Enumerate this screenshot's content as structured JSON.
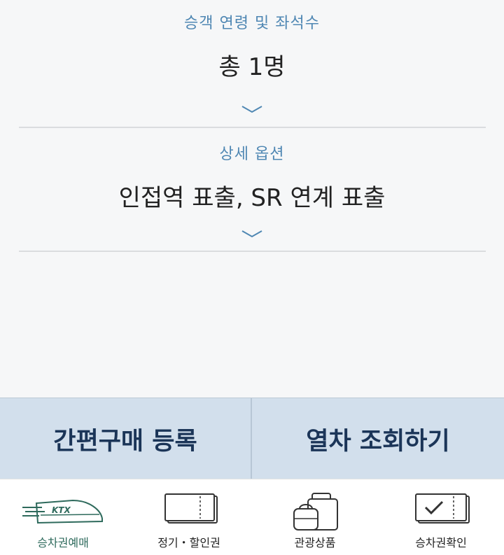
{
  "passenger_section": {
    "label": "승객 연령 및 좌석수",
    "value": "총 1명"
  },
  "options_section": {
    "label": "상세 옵션",
    "value": "인접역 표출, SR 연계 표출"
  },
  "actions": {
    "register_label": "간편구매 등록",
    "search_label": "열차 조회하기"
  },
  "tabbar": {
    "items": [
      {
        "label": "승차권예매",
        "icon": "ktx-train-icon",
        "active": true,
        "logo_text": "KTX"
      },
      {
        "label": "정기・할인권",
        "icon": "ticket-icon",
        "active": false
      },
      {
        "label": "관광상품",
        "icon": "luggage-icon",
        "active": false
      },
      {
        "label": "승차권확인",
        "icon": "ticket-check-icon",
        "active": false
      }
    ]
  },
  "colors": {
    "label_blue": "#4f87b3",
    "button_bg": "#d2dfec",
    "button_text": "#1b3558",
    "active_tab": "#2e6a5c"
  }
}
